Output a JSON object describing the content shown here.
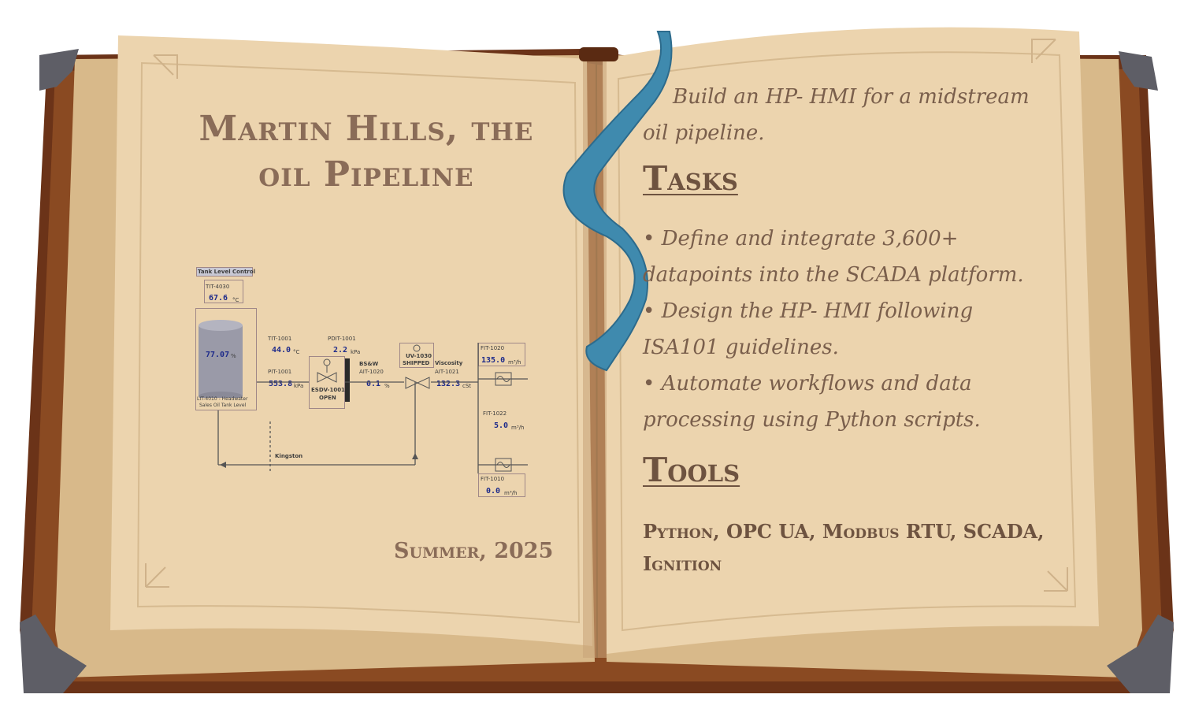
{
  "cover": {
    "title": "Martin Hills, the oil Pipeline",
    "date": "Summer, 2025"
  },
  "hmi_diagram": {
    "tank_level_control_label": "Tank Level Control",
    "tit4030_tag": "TIT-4030",
    "tit4030_value": "67.6",
    "tit4030_unit": "°C",
    "tank_value": "77.07",
    "tank_unit": "%",
    "tank_caption_line1": "LIT-4010 - Headwater",
    "tank_caption_line2": "Sales Oil Tank Level",
    "tit1001_tag": "TIT-1001",
    "tit1001_value": "44.0",
    "tit1001_unit": "°C",
    "pit1001_tag": "PIT-1001",
    "pit1001_value": "553.8",
    "pit1001_unit": "kPa",
    "pdit1001_tag": "PDIT-1001",
    "pdit1001_value": "2.2",
    "pdit1001_unit": "kPa",
    "esdv_label": "ESDV-1001",
    "esdv_state": "OPEN",
    "bsw_label": "BS&W",
    "ait1020_tag": "AIT-1020",
    "ait1020_value": "0.1",
    "ait1020_unit": "%",
    "uv_label": "UV-1030",
    "uv_state": "SHIPPED",
    "viscosity_label": "Viscosity",
    "ait1021_tag": "AIT-1021",
    "ait1021_value": "132.3",
    "ait1021_unit": "cSt",
    "fit1020_tag": "FIT-1020",
    "fit1020_value": "135.0",
    "fit1020_unit": "m³/h",
    "fit1022_tag": "FIT-1022",
    "fit1022_value": "5.0",
    "fit1022_unit": "m³/h",
    "fit1010_tag": "FIT-1010",
    "fit1010_value": "0.0",
    "fit1010_unit": "m³/h",
    "kingston_label": "Kingston"
  },
  "right_page": {
    "intro": "Build an HP- HMI for a midstream oil pipeline.",
    "tasks_heading": "Tasks",
    "tasks": [
      "• Define and integrate 3,600+ datapoints into the SCADA platform.",
      "• Design the HP- HMI following ISA101 guidelines.",
      "• Automate workflows and data processing using Python scripts."
    ],
    "tools_heading": "Tools",
    "tools": "Python, OPC UA, Modbus RTU, SCADA, Ignition"
  },
  "colors": {
    "page": "#ecd4ae",
    "cover": "#6b3318",
    "corner": "#5e5e66",
    "ribbon": "#3f8aae",
    "ink": "#7a5f4c"
  }
}
